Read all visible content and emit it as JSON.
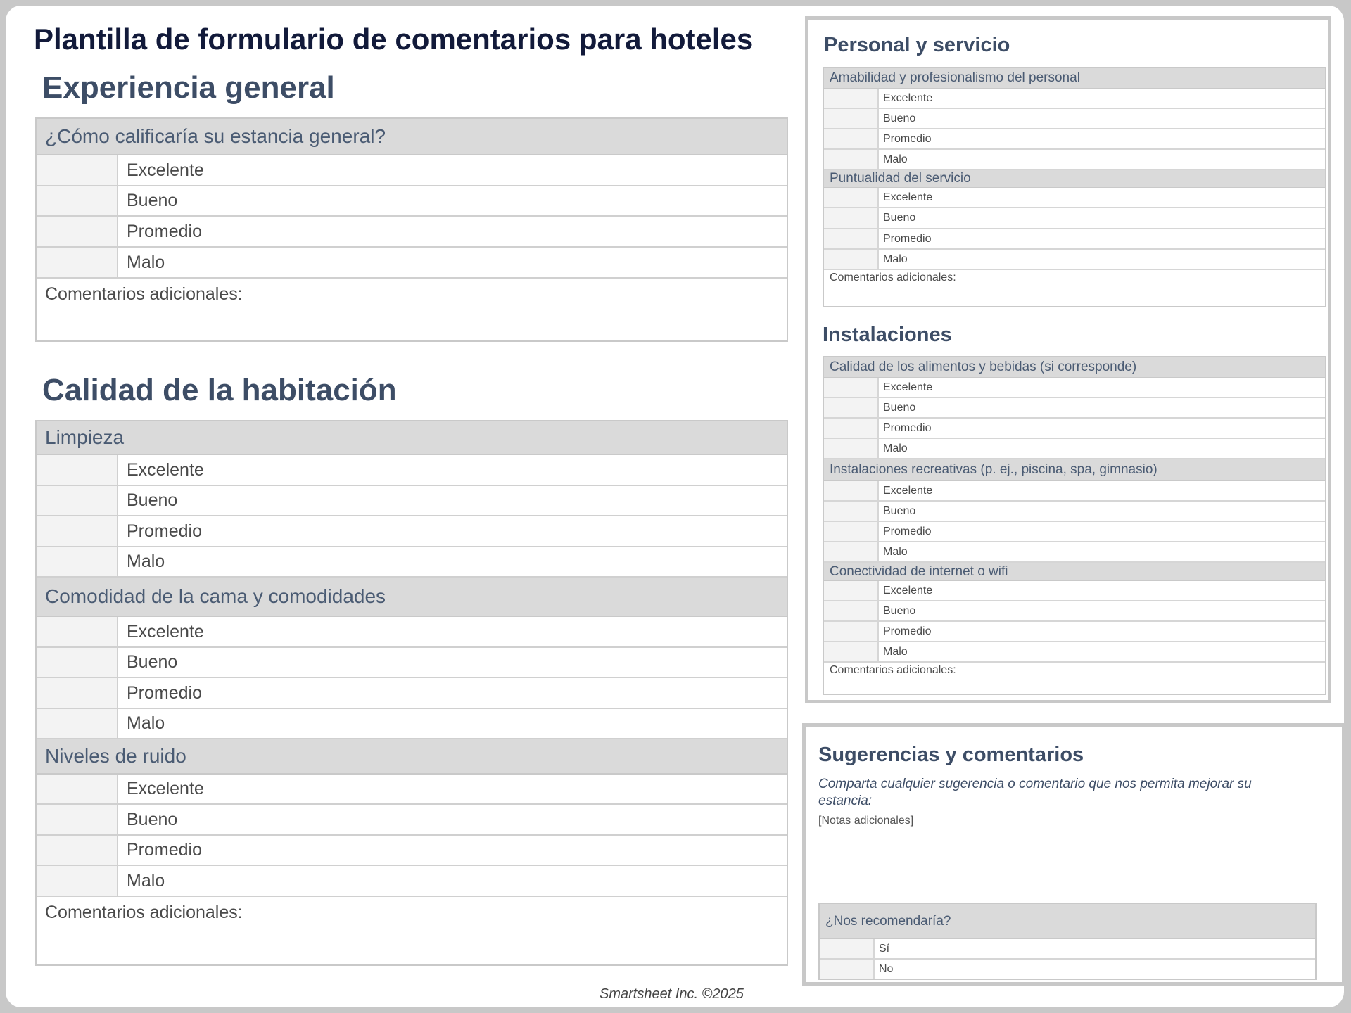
{
  "title": "Plantilla de formulario de comentarios para hoteles",
  "options": [
    "Excelente",
    "Bueno",
    "Promedio",
    "Malo"
  ],
  "comments_label": "Comentarios adicionales:",
  "general": {
    "heading": "Experiencia general",
    "question": "¿Cómo calificaría su estancia general?"
  },
  "room": {
    "heading": "Calidad de la habitación",
    "questions": [
      "Limpieza",
      "Comodidad de la cama y comodidades",
      "Niveles de ruido"
    ]
  },
  "staff": {
    "heading": "Personal y servicio",
    "questions": [
      "Amabilidad y profesionalismo del personal",
      "Puntualidad del servicio"
    ]
  },
  "facilities": {
    "heading": "Instalaciones",
    "questions": [
      "Calidad de los alimentos y bebidas (si corresponde)",
      "Instalaciones recreativas (p. ej., piscina, spa, gimnasio)",
      "Conectividad de internet o wifi"
    ]
  },
  "suggestions": {
    "heading": "Sugerencias y comentarios",
    "prompt": "Comparta cualquier sugerencia o comentario que nos permita mejorar su estancia:",
    "notes": "[Notas adicionales]",
    "recommend_question": "¿Nos recomendaría?",
    "recommend_options": [
      "Sí",
      "No"
    ]
  },
  "footer": "Smartsheet Inc. ©2025"
}
